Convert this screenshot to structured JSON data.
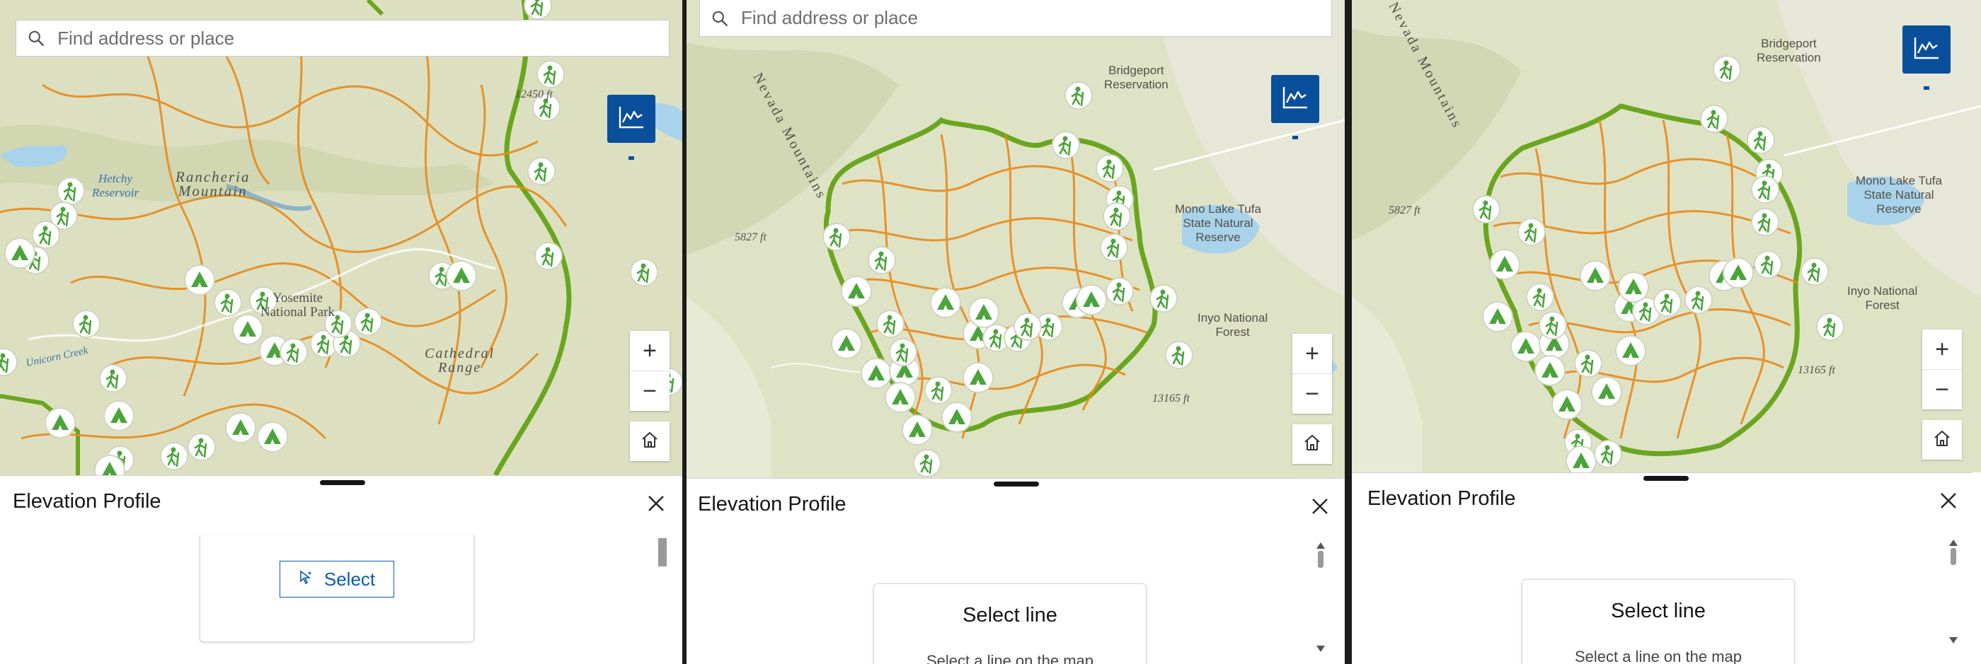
{
  "search": {
    "placeholder": "Find address or place"
  },
  "panel": {
    "title": "Elevation Profile",
    "select_button": "Select",
    "select_line_title": "Select line",
    "select_line_hint": "Select a line on the map"
  },
  "map_labels": {
    "p1": {
      "hetchy": "Hetchy\nReservoir",
      "rancheria": "Rancheria\nMountain",
      "yosemite": "Yosemite\nNational Park",
      "cathedral": "Cathedral\nRange",
      "unicorn": "Unicorn Creek",
      "elev": "12450 ft"
    },
    "p2": {
      "nevada": "Nevada Mountains",
      "bridgeport": "Bridgeport\nReservation",
      "monolake": "Mono Lake Tufa\nState Natural\nReserve",
      "inyo": "Inyo National\nForest",
      "elev1": "5827 ft",
      "elev2": "13165 ft"
    },
    "p3": {
      "nevada": "Nevada Mountains",
      "bridgeport": "Bridgeport\nReservation",
      "monolake": "Mono Lake Tufa\nState Natural\nReserve",
      "inyo": "Inyo National\nForest",
      "elev1": "5827 ft",
      "elev2": "13165 ft"
    }
  },
  "icons": [
    "search-icon",
    "elevation-profile-icon",
    "zoom-in-icon",
    "zoom-out-icon",
    "home-icon",
    "close-icon",
    "select-cursor-icon",
    "hiking-icon",
    "campground-icon"
  ],
  "colors": {
    "accent": "#0a4f9c",
    "trail": "#e88a1a",
    "boundary": "#6aa61e",
    "map_bg": "#dfe3c6",
    "water": "#a9d3ea"
  }
}
